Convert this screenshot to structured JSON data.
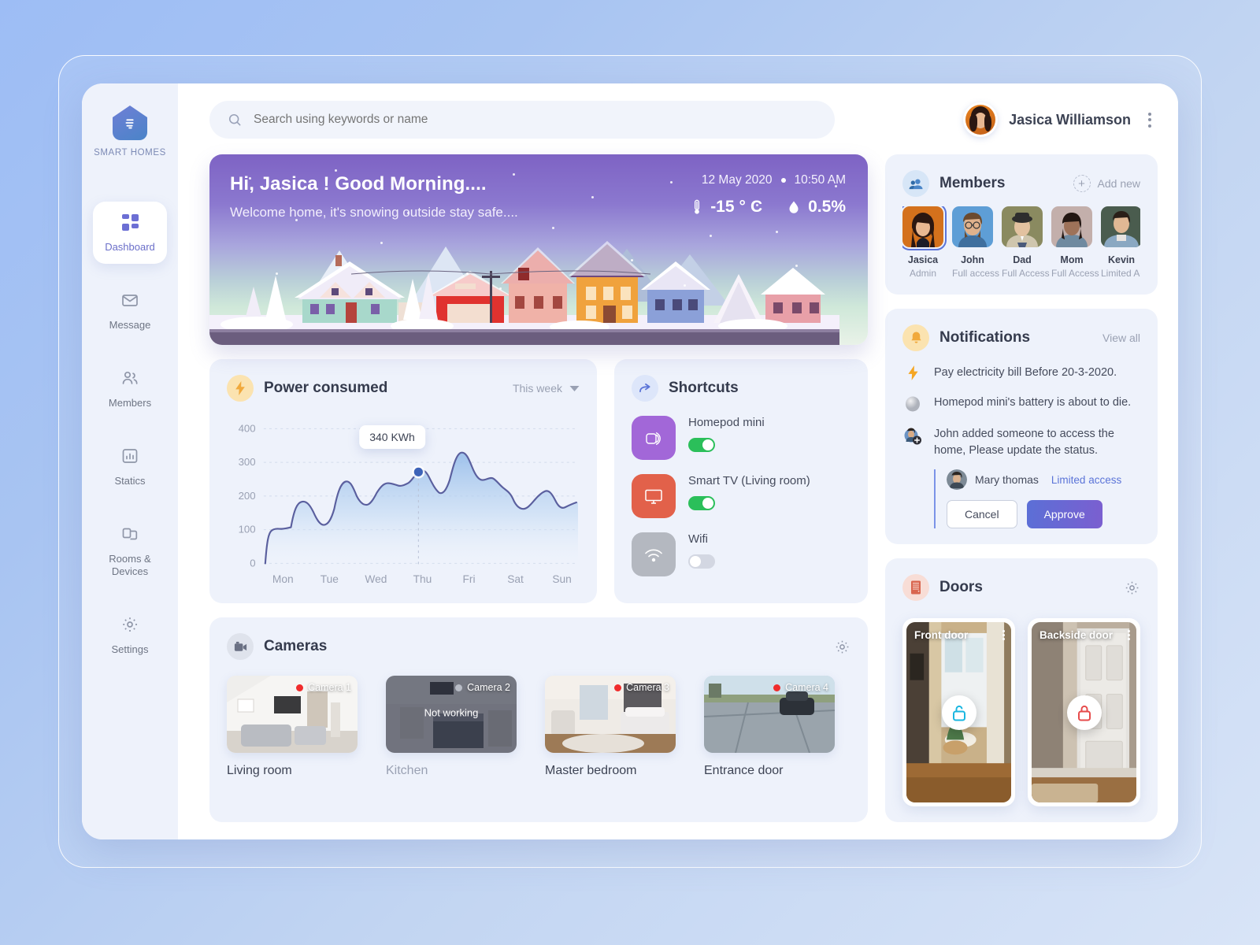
{
  "sidebar": {
    "brand_name": "SMART HOMES",
    "brand_icon": "home-bulb-icon",
    "items": [
      {
        "label": "Dashboard",
        "icon": "grid-icon",
        "active": true
      },
      {
        "label": "Message",
        "icon": "envelope-icon",
        "active": false
      },
      {
        "label": "Members",
        "icon": "people-icon",
        "active": false
      },
      {
        "label": "Statics",
        "icon": "bar-chart-icon",
        "active": false
      },
      {
        "label": "Rooms &\nDevices",
        "icon": "devices-icon",
        "active": false
      },
      {
        "label": "Settings",
        "icon": "gear-icon",
        "active": false
      }
    ]
  },
  "topbar": {
    "search_placeholder": "Search using keywords or name",
    "search_value": "",
    "search_icon": "search-icon",
    "user_name": "Jasica Williamson",
    "menu_icon": "kebab-menu-icon"
  },
  "hero": {
    "greeting": "Hi, Jasica ! Good Morning....",
    "subtitle": "Welcome home, it's snowing outside stay safe....",
    "date": "12 May 2020",
    "time": "10:50 AM",
    "temperature": "-15",
    "temperature_unit": "C",
    "humidity": "0.5%",
    "thermometer_icon": "thermometer-icon",
    "humidity_icon": "water-drop-icon"
  },
  "power": {
    "title": "Power consumed",
    "icon": "lightning-bolt-icon",
    "range_label": "This week",
    "range_caret": "chevron-down-icon",
    "tooltip": "340 KWh"
  },
  "chart_data": {
    "type": "area",
    "title": "Power consumed",
    "xlabel": "",
    "ylabel": "",
    "unit": "KWh",
    "categories": [
      "Mon",
      "Tue",
      "Wed",
      "Thu",
      "Fri",
      "Sat",
      "Sun"
    ],
    "yticks": [
      0,
      100,
      200,
      300,
      400
    ],
    "ylim": [
      0,
      400
    ],
    "grid": true,
    "legend": "none",
    "highlight": {
      "x": "Thu",
      "value": 340,
      "label": "340 KWh"
    },
    "values": [
      5,
      60,
      108,
      112,
      115,
      175,
      160,
      150,
      152,
      230,
      275,
      250,
      218,
      220,
      268,
      272,
      265,
      268,
      300,
      275,
      238,
      290,
      348,
      352,
      310,
      268,
      272,
      280,
      215,
      212,
      240,
      258,
      225,
      215
    ]
  },
  "shortcuts": {
    "title": "Shortcuts",
    "icon": "share-arrow-icon",
    "items": [
      {
        "name": "Homepod mini",
        "icon": "speaker-icon",
        "state": "on",
        "tile_color": "#a濃"
      },
      {
        "name": "Smart TV (Living room)",
        "icon": "tv-icon",
        "state": "on",
        "tile_color": "#e2614a"
      },
      {
        "name": "Wifi",
        "icon": "wifi-icon",
        "state": "off",
        "tile_color": "#b4b8c0"
      }
    ]
  },
  "cameras": {
    "title": "Cameras",
    "icon": "video-camera-icon",
    "settings_icon": "gear-icon",
    "items": [
      {
        "tag": "Camera 1",
        "name": "Living room",
        "status": "live",
        "overlay": ""
      },
      {
        "tag": "Camera 2",
        "name": "Kitchen",
        "status": "offline",
        "overlay": "Not working"
      },
      {
        "tag": "Camera 3",
        "name": "Master bedroom",
        "status": "live",
        "overlay": ""
      },
      {
        "tag": "Camera 4",
        "name": "Entrance door",
        "status": "live",
        "overlay": ""
      }
    ]
  },
  "members": {
    "title": "Members",
    "icon": "members-icon",
    "add_label": "Add new",
    "add_icon": "plus-circle-icon",
    "items": [
      {
        "name": "Jasica",
        "role": "Admin",
        "selected": true
      },
      {
        "name": "John",
        "role": "Full access",
        "selected": false
      },
      {
        "name": "Dad",
        "role": "Full Access",
        "selected": false
      },
      {
        "name": "Mom",
        "role": "Full Access",
        "selected": false
      },
      {
        "name": "Kevin",
        "role": "Limited Ac",
        "selected": false
      }
    ]
  },
  "notifications": {
    "title": "Notifications",
    "icon": "bell-icon",
    "view_all": "View all",
    "items": [
      {
        "icon": "lightning-bolt-icon",
        "text": "Pay electricity bill Before 20-3-2020."
      },
      {
        "icon": "homepod-icon",
        "text": "Homepod mini's battery is about to die."
      },
      {
        "icon": "user-added-icon",
        "text": "John added someone to access the home, Please update the status."
      }
    ],
    "request": {
      "user_name": "Mary thomas",
      "access_level": "Limited access",
      "cancel_label": "Cancel",
      "approve_label": "Approve"
    }
  },
  "doors": {
    "title": "Doors",
    "icon": "door-icon",
    "settings_icon": "gear-icon",
    "items": [
      {
        "name": "Front door",
        "lock_state": "unlocked",
        "lock_icon": "unlock-icon",
        "lock_color": "#19b6e0"
      },
      {
        "name": "Backside door",
        "lock_state": "locked",
        "lock_icon": "lock-icon",
        "lock_color": "#e64b4b"
      }
    ]
  },
  "colors": {
    "accent": "#6c6fd4",
    "accent_blue": "#5b74d8",
    "toggle_on": "#2bbf5a",
    "toggle_off": "#d3d7e2",
    "live_dot": "#f02c2c",
    "card_bg": "#eef2fb",
    "page_bg": "#ffffff"
  }
}
